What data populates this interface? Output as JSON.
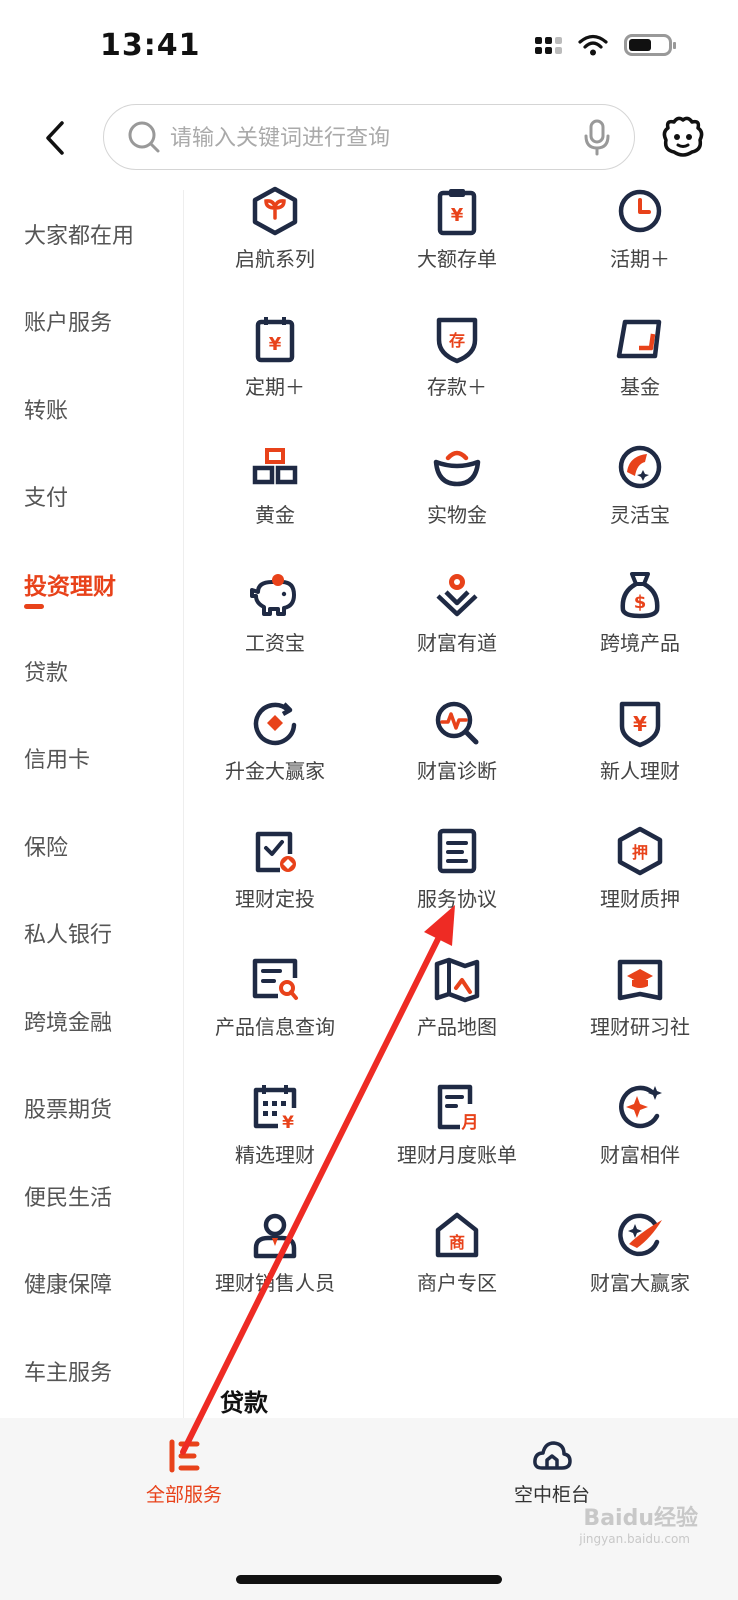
{
  "status_bar": {
    "time": "13:41"
  },
  "search": {
    "placeholder": "请输入关键词进行查询"
  },
  "sidebar": {
    "items": [
      {
        "label": "大家都在用"
      },
      {
        "label": "账户服务"
      },
      {
        "label": "转账"
      },
      {
        "label": "支付"
      },
      {
        "label": "投资理财",
        "active": true
      },
      {
        "label": "贷款"
      },
      {
        "label": "信用卡"
      },
      {
        "label": "保险"
      },
      {
        "label": "私人银行"
      },
      {
        "label": "跨境金融"
      },
      {
        "label": "股票期货"
      },
      {
        "label": "便民生活"
      },
      {
        "label": "健康保障"
      },
      {
        "label": "车主服务"
      }
    ]
  },
  "grid": {
    "items": [
      {
        "label": "启航系列",
        "icon": "sprout-hexagon-icon"
      },
      {
        "label": "大额存单",
        "icon": "clipboard-yuan-icon"
      },
      {
        "label": "活期＋",
        "icon": "clock-icon"
      },
      {
        "label": "定期＋",
        "icon": "calendar-yuan-icon"
      },
      {
        "label": "存款＋",
        "icon": "deposit-shield-icon"
      },
      {
        "label": "基金",
        "icon": "fund-frame-icon"
      },
      {
        "label": "黄金",
        "icon": "gold-bars-icon"
      },
      {
        "label": "实物金",
        "icon": "gold-ingot-icon"
      },
      {
        "label": "灵活宝",
        "icon": "flexible-treasure-icon"
      },
      {
        "label": "工资宝",
        "icon": "piggy-bank-icon"
      },
      {
        "label": "财富有道",
        "icon": "location-diamond-icon"
      },
      {
        "label": "跨境产品",
        "icon": "money-bag-icon"
      },
      {
        "label": "升金大赢家",
        "icon": "target-rotate-icon"
      },
      {
        "label": "财富诊断",
        "icon": "magnifier-pulse-icon"
      },
      {
        "label": "新人理财",
        "icon": "shield-yuan-icon"
      },
      {
        "label": "理财定投",
        "icon": "checklist-clipboard-icon"
      },
      {
        "label": "服务协议",
        "icon": "document-lines-icon"
      },
      {
        "label": "理财质押",
        "icon": "pledge-hexagon-icon"
      },
      {
        "label": "产品信息查询",
        "icon": "product-search-icon"
      },
      {
        "label": "产品地图",
        "icon": "map-icon"
      },
      {
        "label": "理财研习社",
        "icon": "graduation-cap-icon"
      },
      {
        "label": "精选理财",
        "icon": "calendar-grid-yuan-icon"
      },
      {
        "label": "理财月度账单",
        "icon": "monthly-bill-icon"
      },
      {
        "label": "财富相伴",
        "icon": "sparkle-circle-icon"
      },
      {
        "label": "理财销售人员",
        "icon": "person-icon"
      },
      {
        "label": "商户专区",
        "icon": "merchant-house-icon"
      },
      {
        "label": "财富大赢家",
        "icon": "rocket-circle-icon"
      }
    ]
  },
  "section_heading": "贷款",
  "tabbar": {
    "tabs": [
      {
        "label": "全部服务",
        "active": true,
        "icon": "all-services-icon"
      },
      {
        "label": "空中柜台",
        "icon": "cloud-counter-icon"
      }
    ]
  },
  "watermark": {
    "text": "Baidu经验",
    "sub": "jingyan.baidu.com"
  },
  "colors": {
    "accent": "#e8421a",
    "icon_dark": "#1f2a44",
    "annotation_arrow": "#ee2b24"
  }
}
